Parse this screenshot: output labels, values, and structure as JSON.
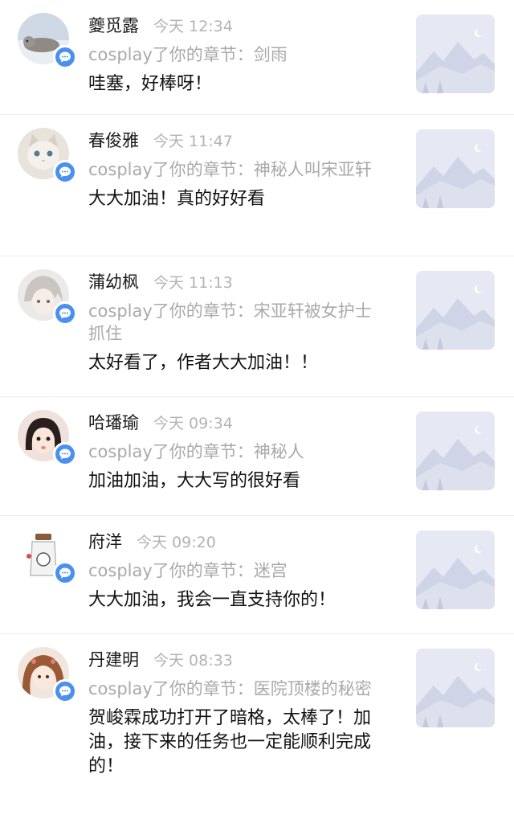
{
  "notifications": [
    {
      "name": "夔觅露",
      "time": "今天 12:34",
      "chapter": "cosplay了你的章节：剑雨",
      "comment": "哇塞，好棒呀！",
      "avatar_theme": "seal-avatar"
    },
    {
      "name": "春俊雅",
      "time": "今天 11:47",
      "chapter": "cosplay了你的章节：神秘人叫宋亚轩",
      "comment": "大大加油！真的好好看",
      "avatar_theme": "cat-avatar"
    },
    {
      "name": "蒲幼枫",
      "time": "今天 11:13",
      "chapter": "cosplay了你的章节：宋亚轩被女护士抓住",
      "comment": "太好看了，作者大大加油！！",
      "avatar_theme": "anime-avatar"
    },
    {
      "name": "哈璠瑜",
      "time": "今天 09:34",
      "chapter": "cosplay了你的章节：神秘人",
      "comment": "加油加油，大大写的很好看",
      "avatar_theme": "girl-avatar"
    },
    {
      "name": "府洋",
      "time": "今天 09:20",
      "chapter": "cosplay了你的章节：迷宫",
      "comment": "大大加油，我会一直支持你的！",
      "avatar_theme": "bottle-avatar"
    },
    {
      "name": "丹建明",
      "time": "今天 08:33",
      "chapter": "cosplay了你的章节：医院顶楼的秘密",
      "comment": "贺峻霖成功打开了暗格，太棒了！加油，接下来的任务也一定能顺利完成的！",
      "avatar_theme": "flower-girl-avatar"
    }
  ],
  "colors": {
    "badge": "#4a90f0",
    "meta_text": "#a9a9a9",
    "thumb_bg": "#e6e9f4",
    "divider": "#ececec"
  },
  "icons": {
    "badge": "chat-bubble-icon",
    "thumbnail": "mountain-placeholder-icon"
  }
}
